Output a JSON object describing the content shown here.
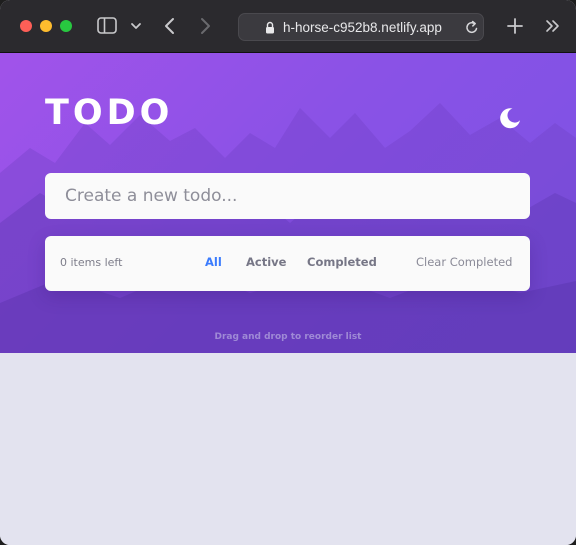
{
  "browser": {
    "url": "h-horse-c952b8.netlify.app",
    "icons": [
      "sidebar-icon",
      "chevron-down-icon",
      "back-arrow-icon",
      "forward-arrow-icon",
      "lock-icon",
      "reload-icon",
      "plus-icon",
      "double-chevron-right-icon"
    ]
  },
  "app": {
    "title": "TODO",
    "theme_icon": "moon-icon",
    "new_todo_placeholder": "Create a new todo...",
    "items_left": "0 items left",
    "filters": {
      "all": "All",
      "active": "Active",
      "completed": "Completed"
    },
    "active_filter": "All",
    "clear_completed": "Clear Completed",
    "hint": "Drag and drop to reorder list"
  },
  "colors": {
    "accent": "#3a7bfd",
    "hero_gradient_start": "#a153ea",
    "hero_gradient_end": "#7a53e4",
    "page_background": "#e3e3ef",
    "card_background": "#fafafa"
  }
}
